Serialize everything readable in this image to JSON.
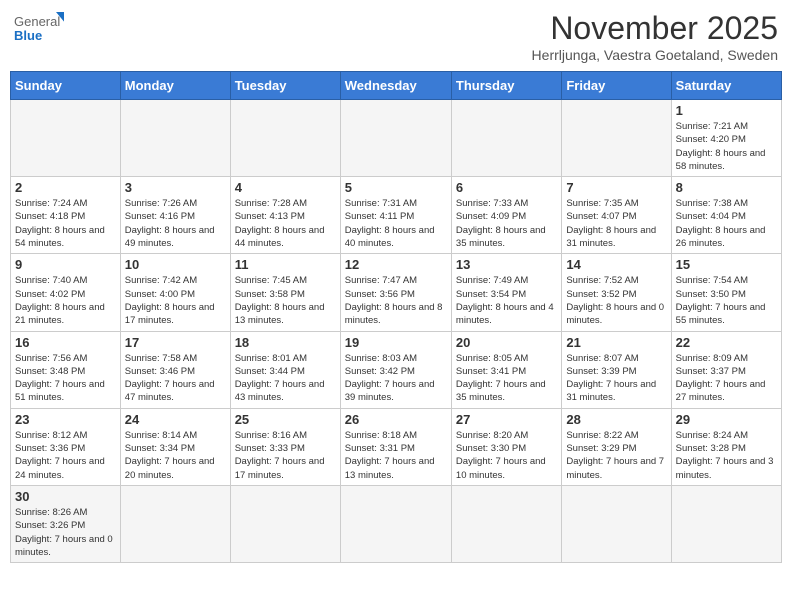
{
  "header": {
    "logo_general": "General",
    "logo_blue": "Blue",
    "month_title": "November 2025",
    "subtitle": "Herrljunga, Vaestra Goetaland, Sweden"
  },
  "weekdays": [
    "Sunday",
    "Monday",
    "Tuesday",
    "Wednesday",
    "Thursday",
    "Friday",
    "Saturday"
  ],
  "days": {
    "d1": {
      "num": "1",
      "sr": "7:21 AM",
      "ss": "4:20 PM",
      "dl": "8 hours and 58 minutes."
    },
    "d2": {
      "num": "2",
      "sr": "7:24 AM",
      "ss": "4:18 PM",
      "dl": "8 hours and 54 minutes."
    },
    "d3": {
      "num": "3",
      "sr": "7:26 AM",
      "ss": "4:16 PM",
      "dl": "8 hours and 49 minutes."
    },
    "d4": {
      "num": "4",
      "sr": "7:28 AM",
      "ss": "4:13 PM",
      "dl": "8 hours and 44 minutes."
    },
    "d5": {
      "num": "5",
      "sr": "7:31 AM",
      "ss": "4:11 PM",
      "dl": "8 hours and 40 minutes."
    },
    "d6": {
      "num": "6",
      "sr": "7:33 AM",
      "ss": "4:09 PM",
      "dl": "8 hours and 35 minutes."
    },
    "d7": {
      "num": "7",
      "sr": "7:35 AM",
      "ss": "4:07 PM",
      "dl": "8 hours and 31 minutes."
    },
    "d8": {
      "num": "8",
      "sr": "7:38 AM",
      "ss": "4:04 PM",
      "dl": "8 hours and 26 minutes."
    },
    "d9": {
      "num": "9",
      "sr": "7:40 AM",
      "ss": "4:02 PM",
      "dl": "8 hours and 21 minutes."
    },
    "d10": {
      "num": "10",
      "sr": "7:42 AM",
      "ss": "4:00 PM",
      "dl": "8 hours and 17 minutes."
    },
    "d11": {
      "num": "11",
      "sr": "7:45 AM",
      "ss": "3:58 PM",
      "dl": "8 hours and 13 minutes."
    },
    "d12": {
      "num": "12",
      "sr": "7:47 AM",
      "ss": "3:56 PM",
      "dl": "8 hours and 8 minutes."
    },
    "d13": {
      "num": "13",
      "sr": "7:49 AM",
      "ss": "3:54 PM",
      "dl": "8 hours and 4 minutes."
    },
    "d14": {
      "num": "14",
      "sr": "7:52 AM",
      "ss": "3:52 PM",
      "dl": "8 hours and 0 minutes."
    },
    "d15": {
      "num": "15",
      "sr": "7:54 AM",
      "ss": "3:50 PM",
      "dl": "7 hours and 55 minutes."
    },
    "d16": {
      "num": "16",
      "sr": "7:56 AM",
      "ss": "3:48 PM",
      "dl": "7 hours and 51 minutes."
    },
    "d17": {
      "num": "17",
      "sr": "7:58 AM",
      "ss": "3:46 PM",
      "dl": "7 hours and 47 minutes."
    },
    "d18": {
      "num": "18",
      "sr": "8:01 AM",
      "ss": "3:44 PM",
      "dl": "7 hours and 43 minutes."
    },
    "d19": {
      "num": "19",
      "sr": "8:03 AM",
      "ss": "3:42 PM",
      "dl": "7 hours and 39 minutes."
    },
    "d20": {
      "num": "20",
      "sr": "8:05 AM",
      "ss": "3:41 PM",
      "dl": "7 hours and 35 minutes."
    },
    "d21": {
      "num": "21",
      "sr": "8:07 AM",
      "ss": "3:39 PM",
      "dl": "7 hours and 31 minutes."
    },
    "d22": {
      "num": "22",
      "sr": "8:09 AM",
      "ss": "3:37 PM",
      "dl": "7 hours and 27 minutes."
    },
    "d23": {
      "num": "23",
      "sr": "8:12 AM",
      "ss": "3:36 PM",
      "dl": "7 hours and 24 minutes."
    },
    "d24": {
      "num": "24",
      "sr": "8:14 AM",
      "ss": "3:34 PM",
      "dl": "7 hours and 20 minutes."
    },
    "d25": {
      "num": "25",
      "sr": "8:16 AM",
      "ss": "3:33 PM",
      "dl": "7 hours and 17 minutes."
    },
    "d26": {
      "num": "26",
      "sr": "8:18 AM",
      "ss": "3:31 PM",
      "dl": "7 hours and 13 minutes."
    },
    "d27": {
      "num": "27",
      "sr": "8:20 AM",
      "ss": "3:30 PM",
      "dl": "7 hours and 10 minutes."
    },
    "d28": {
      "num": "28",
      "sr": "8:22 AM",
      "ss": "3:29 PM",
      "dl": "7 hours and 7 minutes."
    },
    "d29": {
      "num": "29",
      "sr": "8:24 AM",
      "ss": "3:28 PM",
      "dl": "7 hours and 3 minutes."
    },
    "d30": {
      "num": "30",
      "sr": "8:26 AM",
      "ss": "3:26 PM",
      "dl": "7 hours and 0 minutes."
    }
  }
}
